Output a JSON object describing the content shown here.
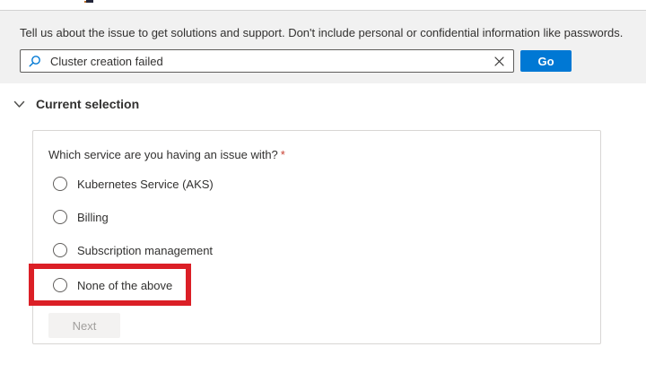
{
  "colors": {
    "accent_blue": "#0078d4",
    "annotation_red": "#db1f26",
    "required_red": "#c84031",
    "panel_gray": "#f1f1f1",
    "text_dark": "#323130",
    "disabled_text": "#a19f9d",
    "disabled_bg": "#f3f2f1"
  },
  "icons": {
    "search_icon": "magnifier",
    "clear_icon": "x-cross",
    "chevron_icon": "chevron-down"
  },
  "intro": {
    "text": "Tell us about the issue to get solutions and support. Don't include personal or confidential information like passwords."
  },
  "search": {
    "value": "Cluster creation failed",
    "go_label": "Go"
  },
  "section": {
    "title": "Current selection"
  },
  "form": {
    "question": "Which service are you having an issue with?",
    "required_marker": "*",
    "options": [
      {
        "label": "Kubernetes Service (AKS)",
        "selected": false
      },
      {
        "label": "Billing",
        "selected": false
      },
      {
        "label": "Subscription management",
        "selected": false
      },
      {
        "label": "None of the above",
        "selected": false,
        "annotated": true
      }
    ],
    "next_label": "Next",
    "next_enabled": false
  }
}
